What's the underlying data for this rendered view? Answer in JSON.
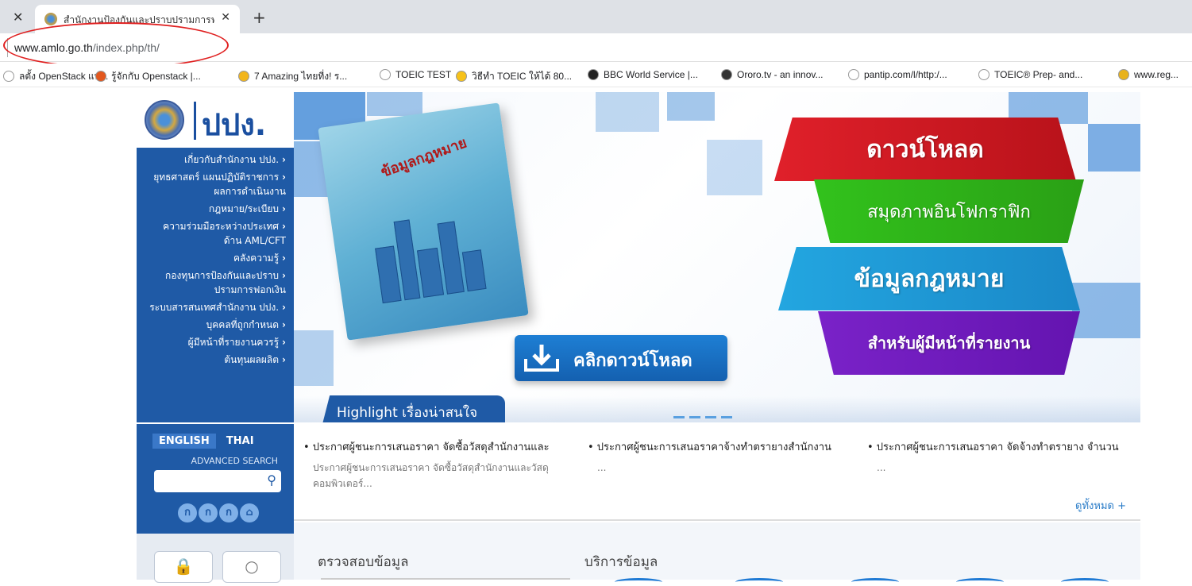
{
  "browser": {
    "tab_title": "สำนักงานป้องกันและปราบปรามการฟอ",
    "url_host": "www.amlo.go.th",
    "url_path": "/index.php/th/",
    "bookmarks": [
      {
        "label": "ลตั้ง OpenStack แบ...",
        "color": "#ffffff"
      },
      {
        "label": "รู้จักกับ Openstack |...",
        "color": "#e2571e"
      },
      {
        "label": "7 Amazing ไทยที่ง! ร...",
        "color": "#f2b51c"
      },
      {
        "label": "TOEIC TEST",
        "color": "#ffffff"
      },
      {
        "label": "วิธีทำ TOEIC ให้ได้ 80...",
        "color": "#f7c21a"
      },
      {
        "label": "BBC World Service |...",
        "color": "#222222"
      },
      {
        "label": "Ororo.tv - an innov...",
        "color": "#333333"
      },
      {
        "label": "pantip.com/l/http:/...",
        "color": "#ffffff"
      },
      {
        "label": "TOEIC® Prep- and...",
        "color": "#ffffff"
      },
      {
        "label": "www.reg...",
        "color": "#e8b21c"
      }
    ]
  },
  "site": {
    "logo_text": "ปปง.",
    "nav": [
      {
        "label": "เกี่ยวกับสำนักงาน ปปง.",
        "arrow": "›"
      },
      {
        "label": "ยุทธศาสตร์ แผนปฏิบัติราชการ",
        "arrow": "›"
      },
      {
        "label": "ผลการดำเนินงาน",
        "arrow": ""
      },
      {
        "label": "กฎหมาย/ระเบียบ",
        "arrow": "›"
      },
      {
        "label": "ความร่วมมือระหว่างประเทศ",
        "arrow": "›"
      },
      {
        "label": "ด้าน AML/CFT",
        "arrow": ""
      },
      {
        "label": "คลังความรู้",
        "arrow": "›"
      },
      {
        "label": "กองทุนการป้องกันและปราบ",
        "arrow": "›"
      },
      {
        "label": "ปรามการฟอกเงิน",
        "arrow": ""
      },
      {
        "label": "ระบบสารสนเทศสำนักงาน ปปง.",
        "arrow": "›"
      },
      {
        "label": "บุคคลที่ถูกกำหนด",
        "arrow": "›"
      },
      {
        "label": "ผู้มีหน้าที่รายงานควรรู้",
        "arrow": "›"
      },
      {
        "label": "ต้นทุนผลผลิต",
        "arrow": "›"
      }
    ],
    "lang_english": "ENGLISH",
    "lang_thai": "THAI",
    "advanced_search": "ADVANCED SEARCH",
    "circle_btns": [
      "ก",
      "ก",
      "ก",
      "⌂"
    ],
    "banner": {
      "book_title": "ข้อมูลกฎหมาย",
      "ribbon1": "ดาวน์โหลด",
      "ribbon2": "สมุดภาพอินโฟกราฟิก",
      "ribbon3": "ข้อมูลกฎหมาย",
      "ribbon4": "สำหรับผู้มีหน้าที่รายงาน",
      "download_btn": "คลิกดาวน์โหลด",
      "highlight_tab": "Highlight เรื่องน่าสนใจ"
    },
    "news": [
      {
        "head": "• ประกาศผู้ชนะการเสนอราคา จัดซื้อวัสดุสำนักงานและ",
        "body": "ประกาศผู้ชนะการเสนอราคา จัดซื้อวัสดุสำนักงานและวัสดุคอมพิวเตอร์..."
      },
      {
        "head": "• ประกาศผู้ชนะการเสนอราคาจ้างทำตรายางสำนักงาน",
        "body": "..."
      },
      {
        "head": "• ประกาศผู้ชนะการเสนอราคา จัดจ้างทำตรายาง จำนวน",
        "body": "..."
      }
    ],
    "see_all": "ดูทั้งหมด +",
    "check_data": "ตรวจสอบข้อมูล",
    "services": "บริการข้อมูล"
  }
}
